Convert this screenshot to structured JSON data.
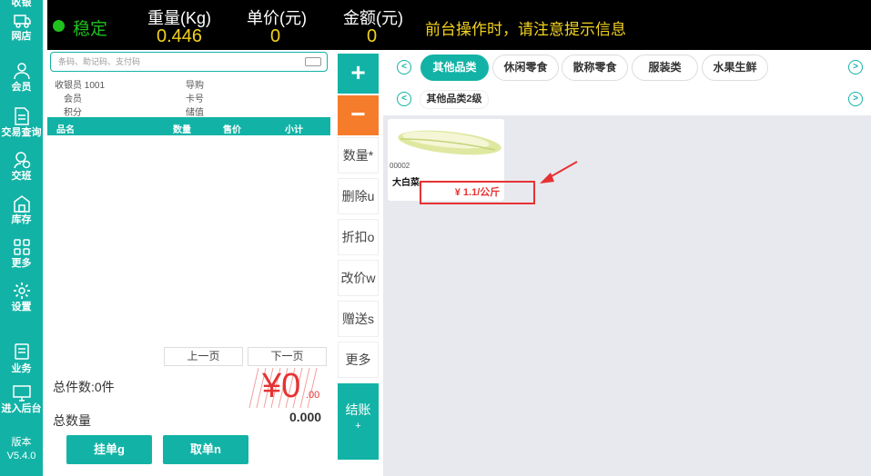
{
  "sidebar": {
    "items": [
      {
        "label": "收银",
        "icon": "cashier-icon"
      },
      {
        "label": "网店",
        "icon": "shop-icon"
      },
      {
        "label": "会员",
        "icon": "member-icon"
      },
      {
        "label": "交易查询",
        "icon": "document-icon"
      },
      {
        "label": "交班",
        "icon": "shift-icon"
      },
      {
        "label": "库存",
        "icon": "warehouse-icon"
      },
      {
        "label": "更多",
        "icon": "grid-icon"
      },
      {
        "label": "设置",
        "icon": "gear-icon"
      },
      {
        "label": "业务",
        "icon": "business-icon"
      },
      {
        "label": "进入后台",
        "icon": "monitor-icon"
      }
    ],
    "version_label": "版本",
    "version": "V5.4.0"
  },
  "topbar": {
    "status": "稳定",
    "weight_label": "重量(Kg)",
    "weight": "0.446",
    "unit_price_label": "单价(元)",
    "unit_price": "0",
    "amount_label": "金额(元)",
    "amount": "0",
    "notice": "前台操作时，请注意提示信息"
  },
  "left": {
    "search_placeholder": "条码、助记码、支付码",
    "cashier_label": "收银员",
    "cashier_id": "1001",
    "guide_label": "导购",
    "member_label": "会员",
    "card_label": "卡号",
    "points_label": "积分",
    "stored_label": "储值",
    "columns": [
      "品名",
      "数量",
      "售价",
      "小计"
    ],
    "prev_page": "上一页",
    "next_page": "下一页",
    "total_items": "总件数:0件",
    "total_qty_label": "总数量",
    "total_qty": "0.000",
    "big_amount": "¥0",
    "big_amount_decimal": ".00",
    "hold_button": "挂单g",
    "retrieve_button": "取单n"
  },
  "mid": {
    "plus": "+",
    "minus": "−",
    "quantity": "数量*",
    "delete": "删除u",
    "discount": "折扣o",
    "change_price": "改价w",
    "gift": "赠送s",
    "more": "更多",
    "checkout": "结账",
    "checkout_key": "+"
  },
  "categories": {
    "items": [
      "其他品类",
      "休闲零食",
      "散称零食",
      "服装类",
      "水果生鲜"
    ],
    "active": 0,
    "sub": [
      "其他品类2级"
    ]
  },
  "products": [
    {
      "code": "00002",
      "name": "大白菜",
      "price": "¥ 1.1/公斤"
    }
  ],
  "colors": {
    "accent": "#12b3a6",
    "minus": "#f57c2a",
    "highlight": "#e63232",
    "status_ok": "#1fc11f",
    "topbar_value": "#f2d21f"
  }
}
